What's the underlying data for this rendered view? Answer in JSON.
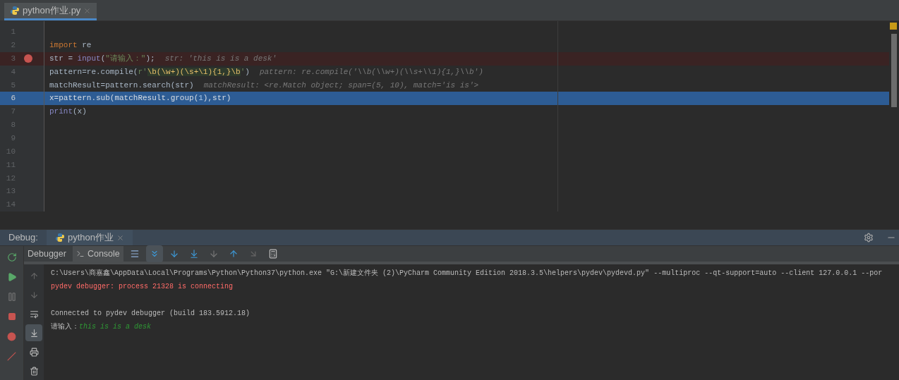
{
  "editor_tabs": [
    {
      "label": "python作业.py",
      "selected": true
    }
  ],
  "code_lines": [
    {
      "number": "1",
      "breakpoint": false,
      "current": false
    },
    {
      "number": "2",
      "tokens": [
        {
          "text": "import",
          "kind": "keyword"
        },
        {
          "text": " re",
          "kind": "plain"
        }
      ],
      "breakpoint": false,
      "current": false
    },
    {
      "number": "3",
      "tokens": [
        {
          "text": "str = ",
          "kind": "plain"
        },
        {
          "text": "input",
          "kind": "builtin"
        },
        {
          "text": "(",
          "kind": "plain"
        },
        {
          "text": "\"请输入：\"",
          "kind": "string"
        },
        {
          "text": ");",
          "kind": "plain"
        }
      ],
      "hint": "str: 'this is is a desk'",
      "breakpoint": true,
      "current": false
    },
    {
      "number": "4",
      "tokens": [
        {
          "text": "pattern=re.compile(",
          "kind": "plain"
        },
        {
          "text": "r'",
          "kind": "string"
        },
        {
          "text": "\\b(\\w+)(\\s+\\1){1,}\\b",
          "kind": "regex"
        },
        {
          "text": "'",
          "kind": "string"
        },
        {
          "text": ")",
          "kind": "plain"
        }
      ],
      "hint": "pattern: re.compile('\\\\b(\\\\w+)(\\\\s+\\\\1){1,}\\\\b')",
      "breakpoint": false,
      "current": false
    },
    {
      "number": "5",
      "tokens": [
        {
          "text": "matchResult=pattern.search(str)",
          "kind": "plain"
        }
      ],
      "hint": "matchResult: <re.Match object; span=(5, 10), match='is is'>",
      "breakpoint": false,
      "current": false
    },
    {
      "number": "6",
      "tokens": [
        {
          "text": "x=pattern.sub(matchResult.group(",
          "kind": "plain"
        },
        {
          "text": "1",
          "kind": "number"
        },
        {
          "text": "),str)",
          "kind": "plain"
        }
      ],
      "breakpoint": false,
      "current": true
    },
    {
      "number": "7",
      "tokens": [
        {
          "text": "print",
          "kind": "builtin"
        },
        {
          "text": "(x)",
          "kind": "plain"
        }
      ],
      "breakpoint": false,
      "current": false
    },
    {
      "number": "8",
      "breakpoint": false,
      "current": false
    },
    {
      "number": "9",
      "breakpoint": false,
      "current": false
    },
    {
      "number": "10",
      "breakpoint": false,
      "current": false
    },
    {
      "number": "11",
      "breakpoint": false,
      "current": false
    },
    {
      "number": "12",
      "breakpoint": false,
      "current": false
    },
    {
      "number": "13",
      "breakpoint": false,
      "current": false
    },
    {
      "number": "14",
      "breakpoint": false,
      "current": false
    }
  ],
  "debug_panel": {
    "title": "Debug:",
    "session_tab": "python作业",
    "tabs": [
      {
        "label": "Debugger",
        "selected": false
      },
      {
        "label": "Console",
        "selected": true
      }
    ],
    "console_lines": [
      {
        "kind": "command",
        "text": "C:\\Users\\商嘉鑫\\AppData\\Local\\Programs\\Python\\Python37\\python.exe \"G:\\新建文件夹 (2)\\PyCharm Community Edition 2018.3.5\\helpers\\pydev\\pydevd.py\" --multiproc --qt-support=auto --client 127.0.0.1 --por"
      },
      {
        "kind": "error",
        "text": "pydev debugger: process 21328 is connecting"
      },
      {
        "kind": "blank"
      },
      {
        "kind": "info",
        "text": "Connected to pydev debugger (build 183.5912.18)"
      },
      {
        "kind": "input",
        "text": "请输入：",
        "input": "this is is a desk"
      }
    ]
  }
}
